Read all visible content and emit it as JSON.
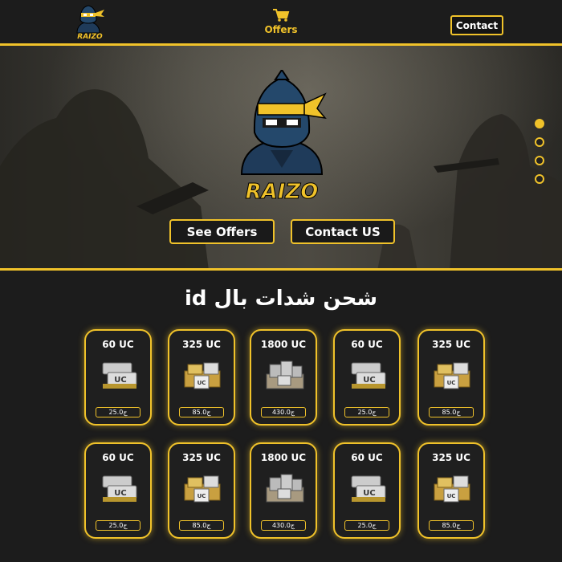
{
  "header": {
    "logo_text": "RAIZO",
    "offers_label": "Offers",
    "contact_label": "Contact"
  },
  "hero": {
    "logo_text": "RAIZO",
    "see_offers_label": "See Offers",
    "contact_us_label": "Contact US",
    "slide_count": 4,
    "active_slide": 1
  },
  "section": {
    "title": "شحن شدات بال id"
  },
  "cards": [
    {
      "uc": "60 UC",
      "price": "25.0ج",
      "pile": "small"
    },
    {
      "uc": "325 UC",
      "price": "85.0ج",
      "pile": "medium"
    },
    {
      "uc": "1800 UC",
      "price": "430.0ج",
      "pile": "large"
    },
    {
      "uc": "60 UC",
      "price": "25.0ج",
      "pile": "small"
    },
    {
      "uc": "325 UC",
      "price": "85.0ج",
      "pile": "medium"
    },
    {
      "uc": "60 UC",
      "price": "25.0ج",
      "pile": "small"
    },
    {
      "uc": "325 UC",
      "price": "85.0ج",
      "pile": "medium"
    },
    {
      "uc": "1800 UC",
      "price": "430.0ج",
      "pile": "large"
    },
    {
      "uc": "60 UC",
      "price": "25.0ج",
      "pile": "small"
    },
    {
      "uc": "325 UC",
      "price": "85.0ج",
      "pile": "medium"
    }
  ],
  "colors": {
    "accent": "#f0c22a",
    "background": "#1c1c1c"
  }
}
